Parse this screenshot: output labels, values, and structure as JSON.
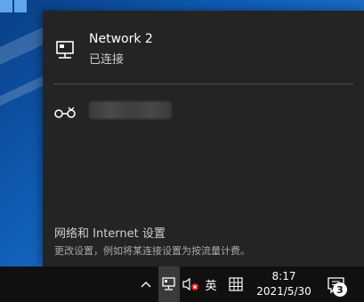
{
  "flyout": {
    "network": {
      "name": "Network 2",
      "status": "已连接",
      "icon": "wired-network-icon"
    },
    "hotspot": {
      "icon": "mobile-hotspot-icon"
    },
    "settings_link": "网络和 Internet 设置",
    "settings_sub": "更改设置，例如将某连接设置为按流量计费。"
  },
  "taskbar": {
    "chevron": "^",
    "ime": "英",
    "time": "8:17",
    "date": "2021/5/30",
    "notifications_count": "3"
  },
  "colors": {
    "flyout_bg": "#242424",
    "taskbar_bg": "#101010",
    "wallpaper": "#0f5bb3",
    "mute_red": "#e81123"
  }
}
